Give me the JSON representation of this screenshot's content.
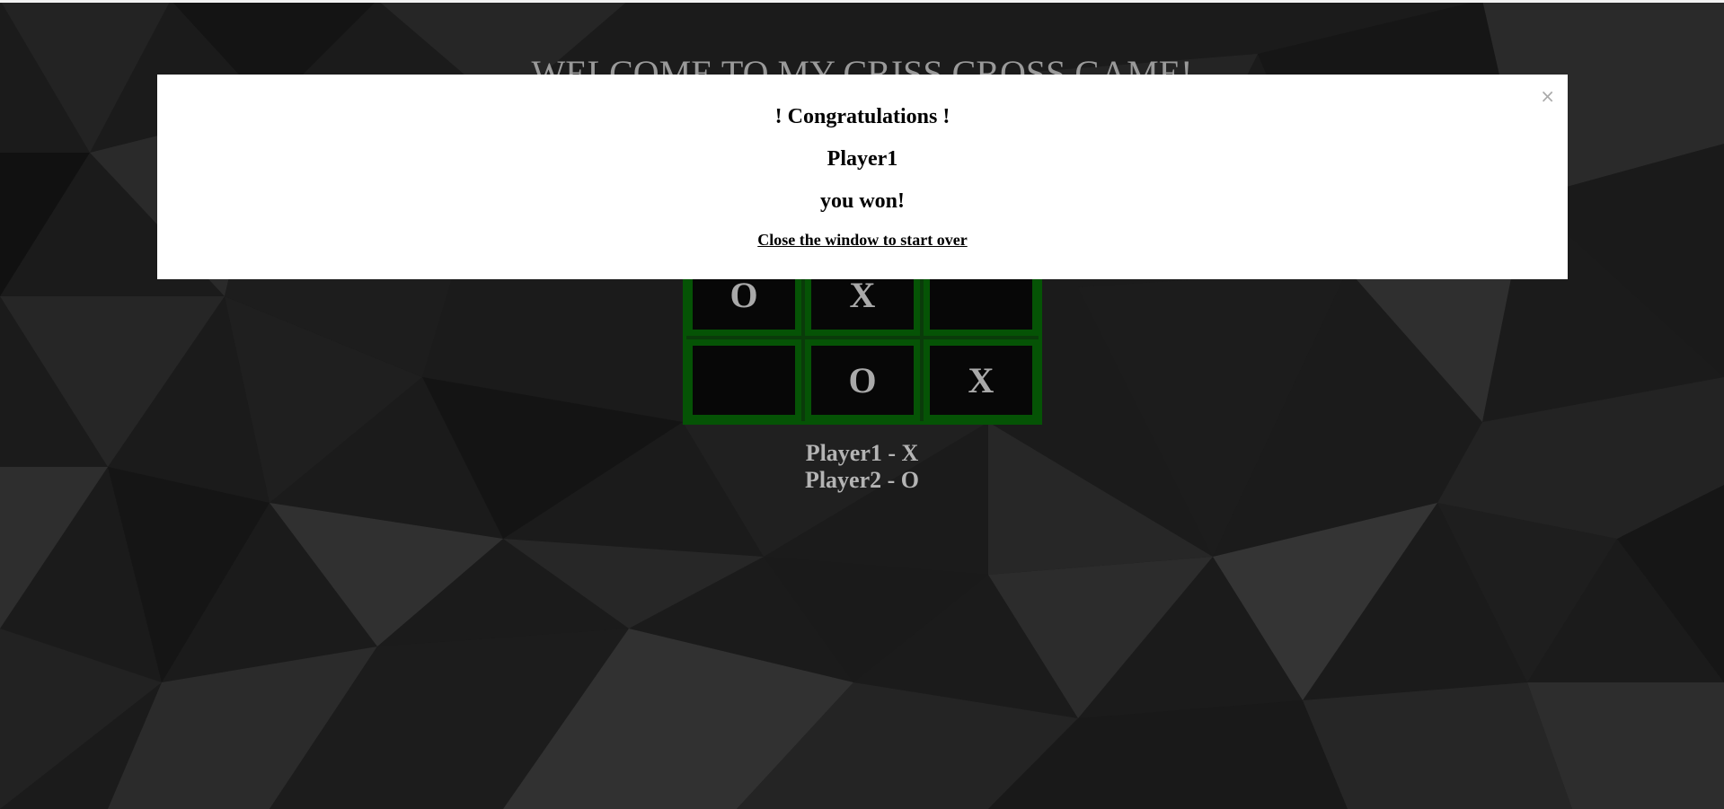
{
  "title": "WELCOME TO MY CRISS CROSS GAME!",
  "board": {
    "cells": [
      "",
      "",
      "",
      "O",
      "X",
      "",
      "",
      "O",
      "X"
    ]
  },
  "players": {
    "p1": "Player1 - X",
    "p2": "Player2 - O"
  },
  "modal": {
    "close_symbol": "×",
    "congrats": "! Congratulations !",
    "winner": "Player1",
    "result": "you won!",
    "restart": "Close the window to start over"
  },
  "colors": {
    "board_green": "#055305",
    "cell_bg": "#070707",
    "text_grey": "#a9a9a9"
  }
}
